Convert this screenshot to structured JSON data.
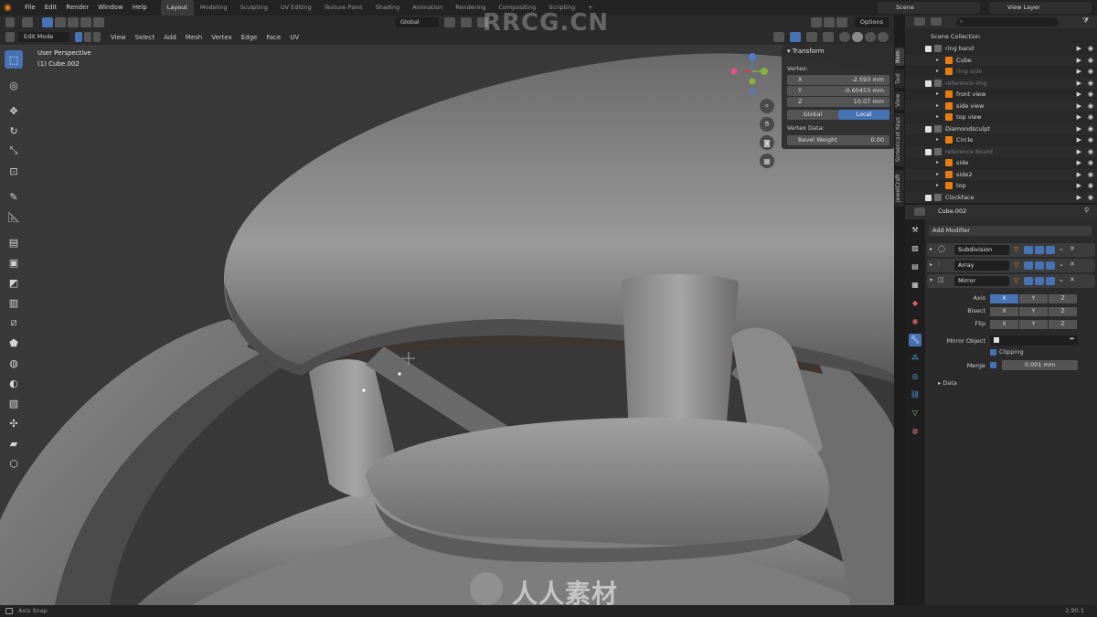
{
  "menu": [
    "File",
    "Edit",
    "Render",
    "Window",
    "Help"
  ],
  "workspaces": [
    "Layout",
    "Modeling",
    "Sculpting",
    "UV Editing",
    "Texture Paint",
    "Shading",
    "Animation",
    "Rendering",
    "Compositing",
    "Scripting"
  ],
  "scene": {
    "label": "Scene",
    "view_layer": "View Layer"
  },
  "tool_header": {
    "orientation": "Global",
    "options": "Options"
  },
  "view_header": {
    "mode": "Edit Mode",
    "menus": [
      "View",
      "Select",
      "Add",
      "Mesh",
      "Vertex",
      "Edge",
      "Face",
      "UV"
    ]
  },
  "viewport": {
    "perspective": "User Perspective",
    "object": "(1) Cube.002"
  },
  "npanel": {
    "title": "Transform",
    "vertex_label": "Vertex:",
    "x_label": "X",
    "x_value": "-2.593 mm",
    "y_label": "Y",
    "y_value": "-0.60453 mm",
    "z_label": "Z",
    "z_value": "10.07 mm",
    "global": "Global",
    "local": "Local",
    "vertex_data": "Vertex Data:",
    "bevel_label": "Bevel Weight",
    "bevel_value": "0.00"
  },
  "side_tabs": [
    "Item",
    "Tool",
    "View",
    "Screencast Keys",
    "JewelCraft"
  ],
  "outliner": {
    "title": "Scene Collection",
    "rows": [
      {
        "name": "ring band",
        "dim": false,
        "depth": 1
      },
      {
        "name": "Cube",
        "dim": false,
        "depth": 2
      },
      {
        "name": "ring side",
        "dim": true,
        "depth": 2
      },
      {
        "name": "reference img",
        "dim": true,
        "depth": 1
      },
      {
        "name": "front view",
        "dim": false,
        "depth": 2
      },
      {
        "name": "side view",
        "dim": false,
        "depth": 2
      },
      {
        "name": "top view",
        "dim": false,
        "depth": 2
      },
      {
        "name": "Diamondsculpt",
        "dim": false,
        "depth": 1
      },
      {
        "name": "Circle",
        "dim": false,
        "depth": 2
      },
      {
        "name": "reference board",
        "dim": true,
        "depth": 1
      },
      {
        "name": "side",
        "dim": false,
        "depth": 2
      },
      {
        "name": "side2",
        "dim": false,
        "depth": 2
      },
      {
        "name": "top",
        "dim": false,
        "depth": 2
      },
      {
        "name": "Clockface",
        "dim": false,
        "depth": 1
      }
    ]
  },
  "properties": {
    "object": "Cube.002",
    "add_modifier": "Add Modifier",
    "modifiers": [
      "Subdivision",
      "Array",
      "Mirror"
    ],
    "axis_label": "Axis",
    "bisect_label": "Bisect",
    "flip_label": "Flip",
    "axes": [
      "X",
      "Y",
      "Z"
    ],
    "mirror_object_label": "Mirror Object",
    "clipping_label": "Clipping",
    "merge_label": "Merge",
    "merge_value": "0.001 mm",
    "data_label": "Data"
  },
  "status": {
    "left": "Axis Snap",
    "right": "2.90.1"
  },
  "watermarks": {
    "top": "RRCG.CN",
    "bottom": "人人素材"
  },
  "colors": {
    "accent": "#4772b3",
    "orange": "#e87d0d",
    "viewport_bg": "#393939"
  }
}
